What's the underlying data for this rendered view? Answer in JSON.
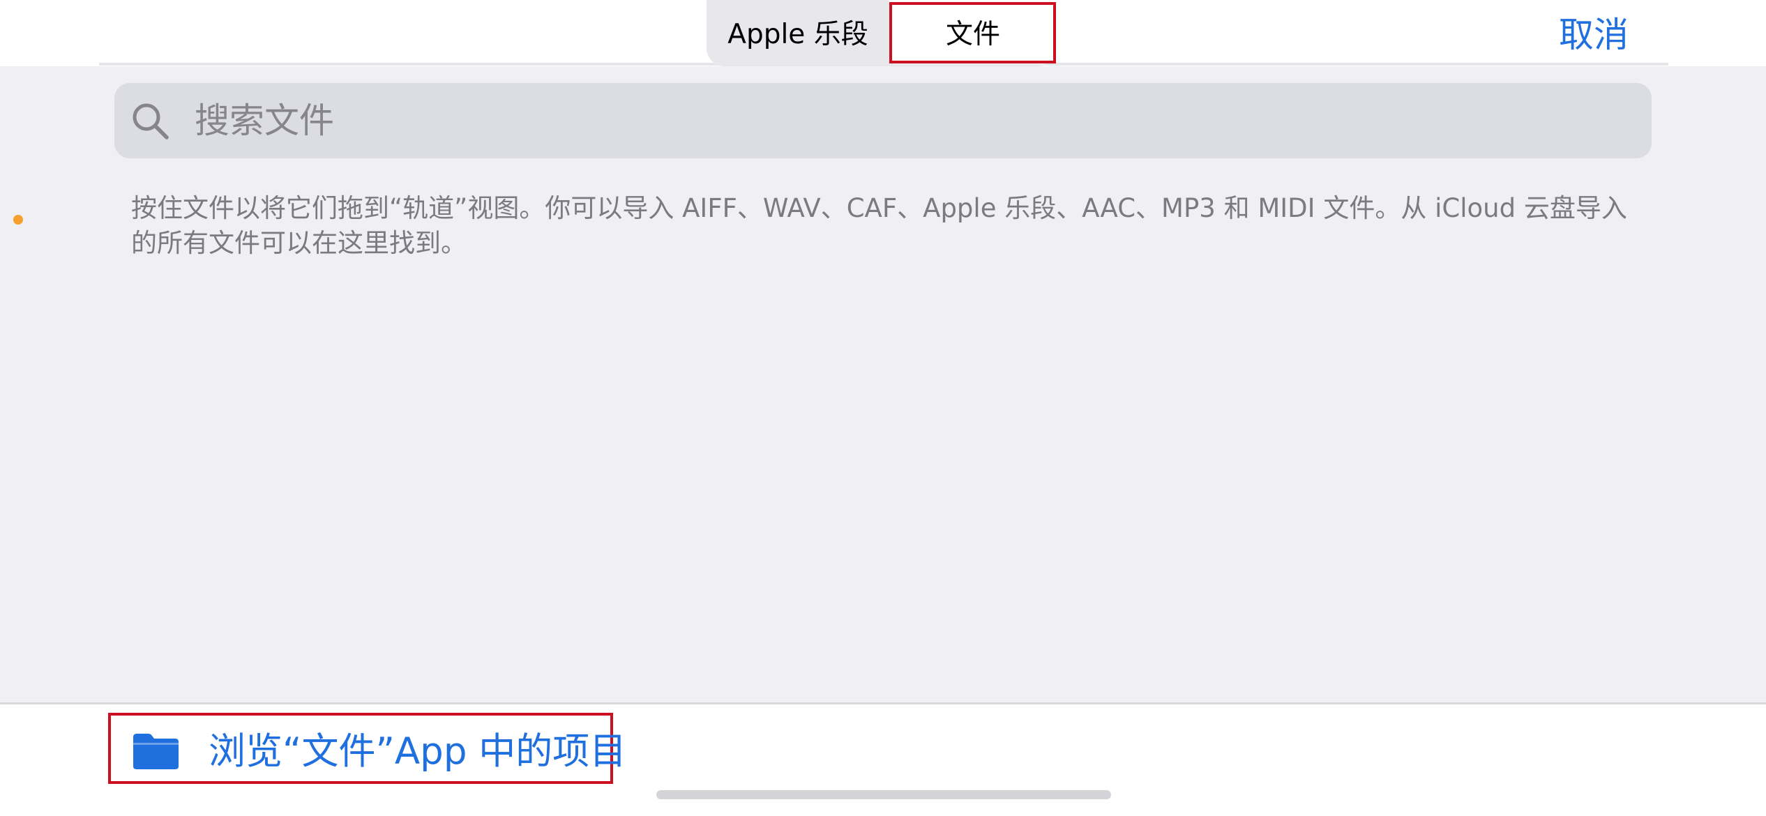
{
  "header": {
    "segments": [
      {
        "label": "Apple 乐段",
        "selected": false
      },
      {
        "label": "文件",
        "selected": true
      }
    ],
    "cancel_label": "取消"
  },
  "search": {
    "placeholder": "搜索文件",
    "value": "",
    "icon": "search-icon"
  },
  "description": "按住文件以将它们拖到“轨道”视图。你可以导入 AIFF、WAV、CAF、Apple 乐段、AAC、MP3 和 MIDI 文件。从 iCloud 云盘导入的所有文件可以在这里找到。",
  "bottom": {
    "browse_label": "浏览“文件”App 中的项目",
    "icon": "folder-icon"
  },
  "colors": {
    "accent": "#1f6fde",
    "highlight": "#cc1020",
    "indicator": "#f5a02e"
  }
}
